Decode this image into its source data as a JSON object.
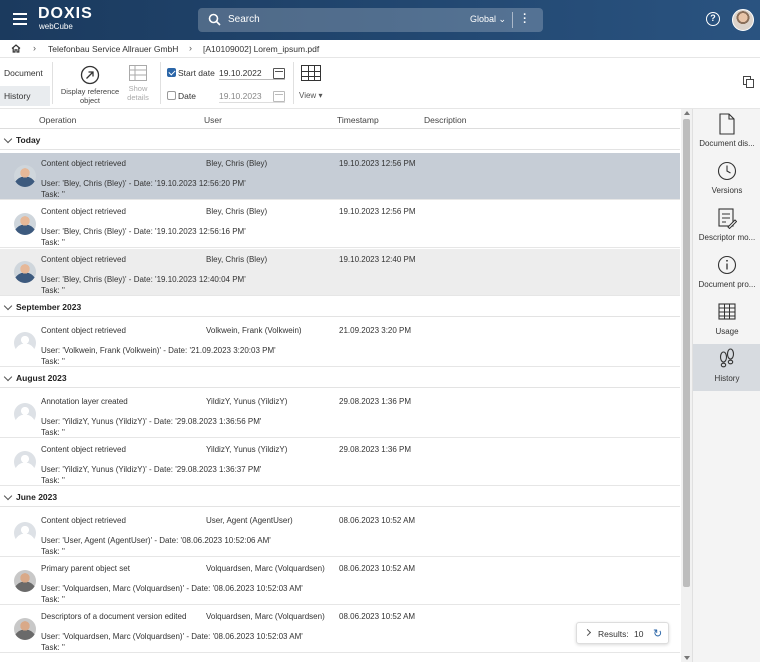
{
  "header": {
    "logo_main": "DOXIS",
    "logo_sub": "webCube",
    "search_placeholder": "Search",
    "search_scope": "Global"
  },
  "breadcrumb": {
    "items": [
      "Telefonbau Service Allrauer GmbH",
      "[A10109002] Lorem_ipsum.pdf"
    ]
  },
  "toolbar": {
    "tabs": [
      "Document",
      "History"
    ],
    "display_reference": "Display reference object",
    "show_details": "Show details",
    "start_date_label": "Start date",
    "start_date_value": "19.10.2022",
    "start_date_checked": true,
    "date_label": "Date",
    "date_value": "19.10.2023",
    "date_checked": false,
    "view_label": "View"
  },
  "columns": [
    "Operation",
    "User",
    "Timestamp",
    "Description"
  ],
  "groups": [
    {
      "label": "Today",
      "rows": [
        {
          "op": "Content object retrieved",
          "user": "Bley, Chris (Bley)",
          "ts": "19.10.2023 12:56 PM",
          "detail": "User: 'Bley, Chris (Bley)' - Date: '19.10.2023 12:56:20 PM'",
          "task": "Task: ''",
          "avatar": "photo"
        },
        {
          "op": "Content object retrieved",
          "user": "Bley, Chris (Bley)",
          "ts": "19.10.2023 12:56 PM",
          "detail": "User: 'Bley, Chris (Bley)' - Date: '19.10.2023 12:56:16 PM'",
          "task": "Task: ''",
          "avatar": "photo"
        },
        {
          "op": "Content object retrieved",
          "user": "Bley, Chris (Bley)",
          "ts": "19.10.2023 12:40 PM",
          "detail": "User: 'Bley, Chris (Bley)' - Date: '19.10.2023 12:40:04 PM'",
          "task": "Task: ''",
          "avatar": "photo"
        }
      ]
    },
    {
      "label": "September 2023",
      "rows": [
        {
          "op": "Content object retrieved",
          "user": "Volkwein, Frank (Volkwein)",
          "ts": "21.09.2023 3:20 PM",
          "detail": "User: 'Volkwein, Frank (Volkwein)' - Date: '21.09.2023 3:20:03 PM'",
          "task": "Task: ''",
          "avatar": "blank"
        }
      ]
    },
    {
      "label": "August 2023",
      "rows": [
        {
          "op": "Annotation layer created",
          "user": "YildizY, Yunus (YildizY)",
          "ts": "29.08.2023 1:36 PM",
          "detail": "User: 'YildizY, Yunus (YildizY)' - Date: '29.08.2023 1:36:56 PM'",
          "task": "Task: ''",
          "avatar": "blank"
        },
        {
          "op": "Content object retrieved",
          "user": "YildizY, Yunus (YildizY)",
          "ts": "29.08.2023 1:36 PM",
          "detail": "User: 'YildizY, Yunus (YildizY)' - Date: '29.08.2023 1:36:37 PM'",
          "task": "Task: ''",
          "avatar": "blank"
        }
      ]
    },
    {
      "label": "June 2023",
      "rows": [
        {
          "op": "Content object retrieved",
          "user": "User, Agent (AgentUser)",
          "ts": "08.06.2023 10:52 AM",
          "detail": "User: 'User, Agent (AgentUser)' - Date: '08.06.2023 10:52:06 AM'",
          "task": "Task: ''",
          "avatar": "blank"
        },
        {
          "op": "Primary parent object set",
          "user": "Volquardsen, Marc (Volquardsen)",
          "ts": "08.06.2023 10:52 AM",
          "detail": "User: 'Volquardsen, Marc (Volquardsen)' - Date: '08.06.2023 10:52:03 AM'",
          "task": "Task: ''",
          "avatar": "photo2"
        },
        {
          "op": "Descriptors of a document version edited",
          "user": "Volquardsen, Marc (Volquardsen)",
          "ts": "08.06.2023 10:52 AM",
          "detail": "User: 'Volquardsen, Marc (Volquardsen)' - Date: '08.06.2023 10:52:03 AM'",
          "task": "Task: ''",
          "avatar": "photo2"
        }
      ]
    }
  ],
  "results": {
    "label": "Results:",
    "value": "10"
  },
  "side_panel": [
    {
      "label": "Document dis...",
      "icon": "document-icon"
    },
    {
      "label": "Versions",
      "icon": "clock-icon"
    },
    {
      "label": "Descriptor mo...",
      "icon": "form-edit-icon"
    },
    {
      "label": "Document pro...",
      "icon": "info-icon"
    },
    {
      "label": "Usage",
      "icon": "table-icon"
    },
    {
      "label": "History",
      "icon": "footsteps-icon"
    }
  ],
  "colors": {
    "header": "#21466f",
    "selected_row": "#c6cdd6",
    "accent": "#2b66a8"
  }
}
